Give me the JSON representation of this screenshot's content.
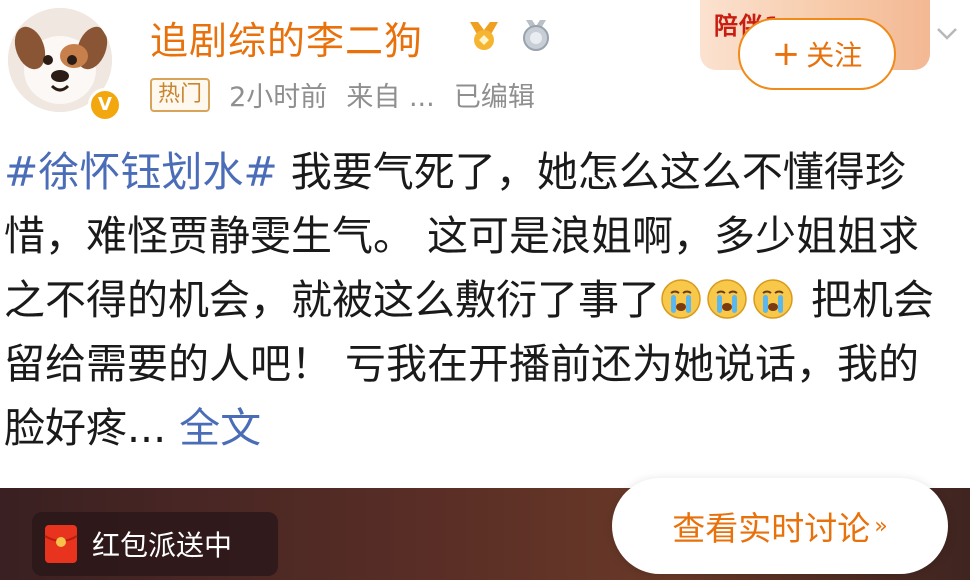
{
  "user": {
    "name": "追剧综的李二狗",
    "verified_badge": "V",
    "medals": [
      "gold-medal-icon",
      "silver-medal-icon"
    ]
  },
  "meta": {
    "hot_tag": "热门",
    "time": "2小时前",
    "source": "来自 ...",
    "edited": "已编辑"
  },
  "banner": {
    "text": "陪伴1"
  },
  "follow": {
    "plus": "+",
    "label": "关注"
  },
  "post": {
    "hashtag": "#徐怀钰划水#",
    "text_before_emoji": " 我要气死了，她怎么这么不懂得珍惜，难怪贾静雯生气。 这可是浪姐啊，多少姐姐求之不得的机会，就被这么敷衍了事了",
    "emojis": [
      "crying-face-icon",
      "crying-face-icon",
      "crying-face-icon"
    ],
    "text_after_emoji": " 把机会留给需要的人吧！ 亏我在开播前还为她说话，我的脸好疼...",
    "full_text_link": " 全文"
  },
  "redpack": {
    "label": "红包派送中"
  },
  "realtime": {
    "label": "查看实时讨论",
    "chevron": "»"
  },
  "colors": {
    "accent": "#e8710c",
    "link": "#4b6db8",
    "meta_gray": "#8f8f8f",
    "hot_tag_border": "#d8a45a"
  }
}
